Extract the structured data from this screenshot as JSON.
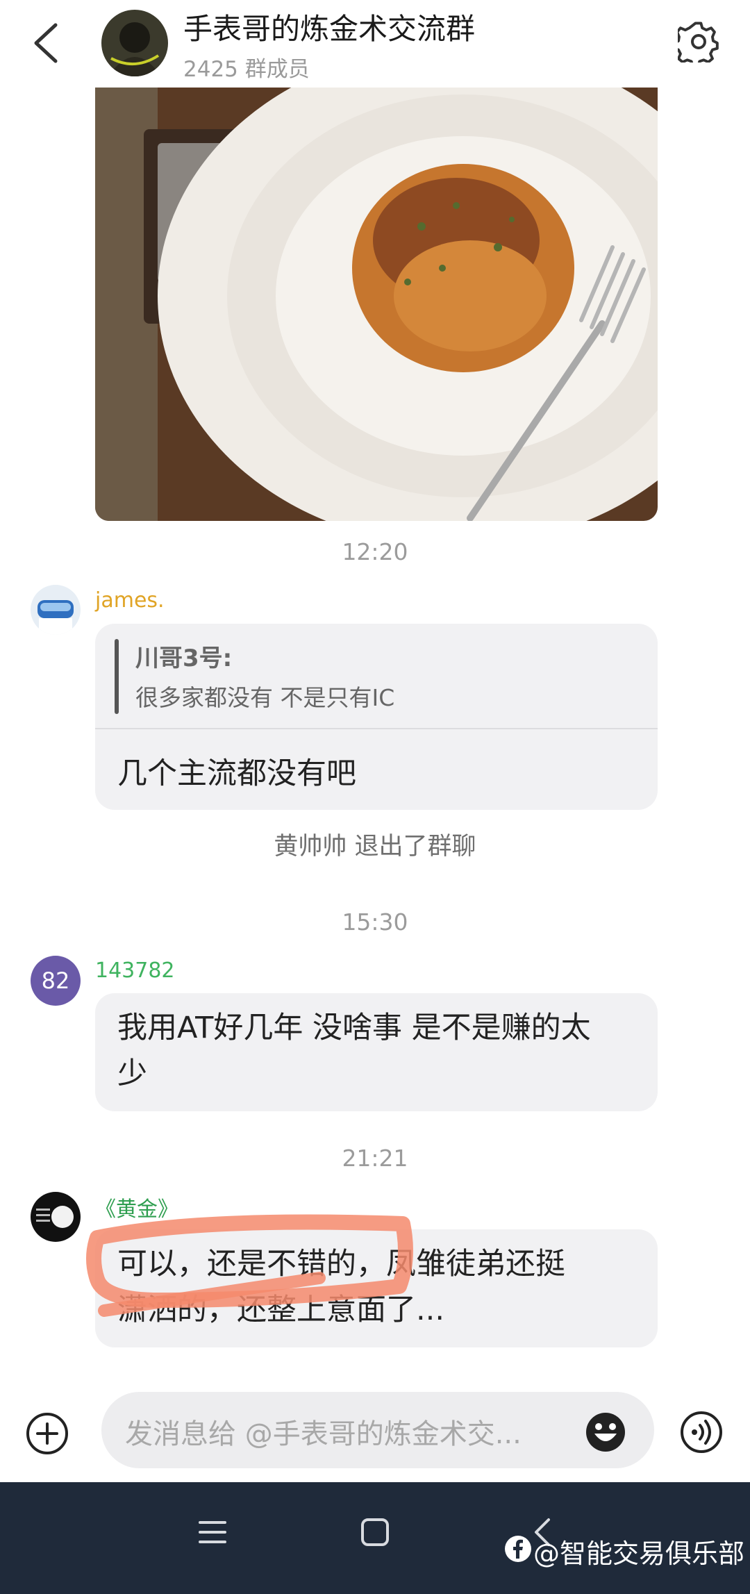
{
  "header": {
    "title": "手表哥的炼金术交流群",
    "member_count": "2425 群成员"
  },
  "messages": [
    {
      "time": "12:20"
    },
    {
      "sender": "james.",
      "quote_author": "川哥3号:",
      "quote_text": "很多家都没有 不是只有IC",
      "text": "几个主流都没有吧"
    },
    {
      "system": "黄帅帅  退出了群聊"
    },
    {
      "time": "15:30"
    },
    {
      "avatar_text": "82",
      "sender": "143782",
      "text_line1": "我用AT好几年 没啥事 是不是赚的太",
      "text_line2": "少"
    },
    {
      "time": "21:21"
    },
    {
      "sender": "《黄金》",
      "text_line1": "可以，还是不错的，凤雏徒弟还挺",
      "text_line2": "潇洒的，还整上意面了..."
    }
  ],
  "input": {
    "placeholder": "发消息给  @手表哥的炼金术交..."
  },
  "watermark": "@智能交易俱乐部",
  "colors": {
    "james_name": "#e0a426",
    "user82_name": "#3fb35f",
    "gold_name": "#2e9e4f",
    "avatar82_bg": "#6a5aa8",
    "highlight": "#f48a6c",
    "nav_bg": "#1f2a3a"
  },
  "icons": [
    "back-arrow-icon",
    "gear-icon",
    "plus-circle-icon",
    "emoji-icon",
    "voice-icon",
    "menu-icon",
    "home-square-icon",
    "back-chevron-icon",
    "facebook-icon"
  ]
}
